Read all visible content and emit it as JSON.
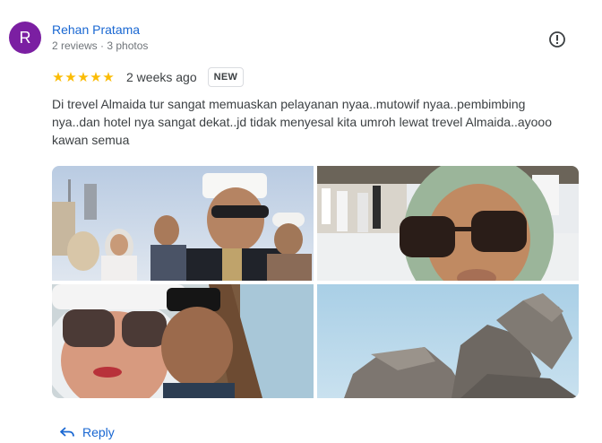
{
  "author": {
    "initial": "R",
    "name": "Rehan Pratama",
    "meta": "2 reviews · 3 photos",
    "avatar_color": "#7b1fa2"
  },
  "review": {
    "rating": 5,
    "stars": [
      "★",
      "★",
      "★",
      "★",
      "★"
    ],
    "time": "2 weeks ago",
    "badge": "NEW",
    "text": "Di trevel Almaida tur sangat memuaskan pelayanan nyaa..mutowif nyaa..pembimbing nya..dan hotel nya sangat dekat..jd tidak menyesal kita umroh lewat trevel Almaida..ayooo kawan semua",
    "star_color": "#fbbc04"
  },
  "photos": [
    {
      "icon": "photo"
    },
    {
      "icon": "photo"
    },
    {
      "icon": "photo"
    },
    {
      "icon": "photo"
    }
  ],
  "actions": {
    "reply_label": "Reply",
    "reply_icon": "reply-arrow-icon",
    "more_icon": "info-icon"
  },
  "colors": {
    "link": "#1967d2",
    "muted": "#70757a"
  }
}
